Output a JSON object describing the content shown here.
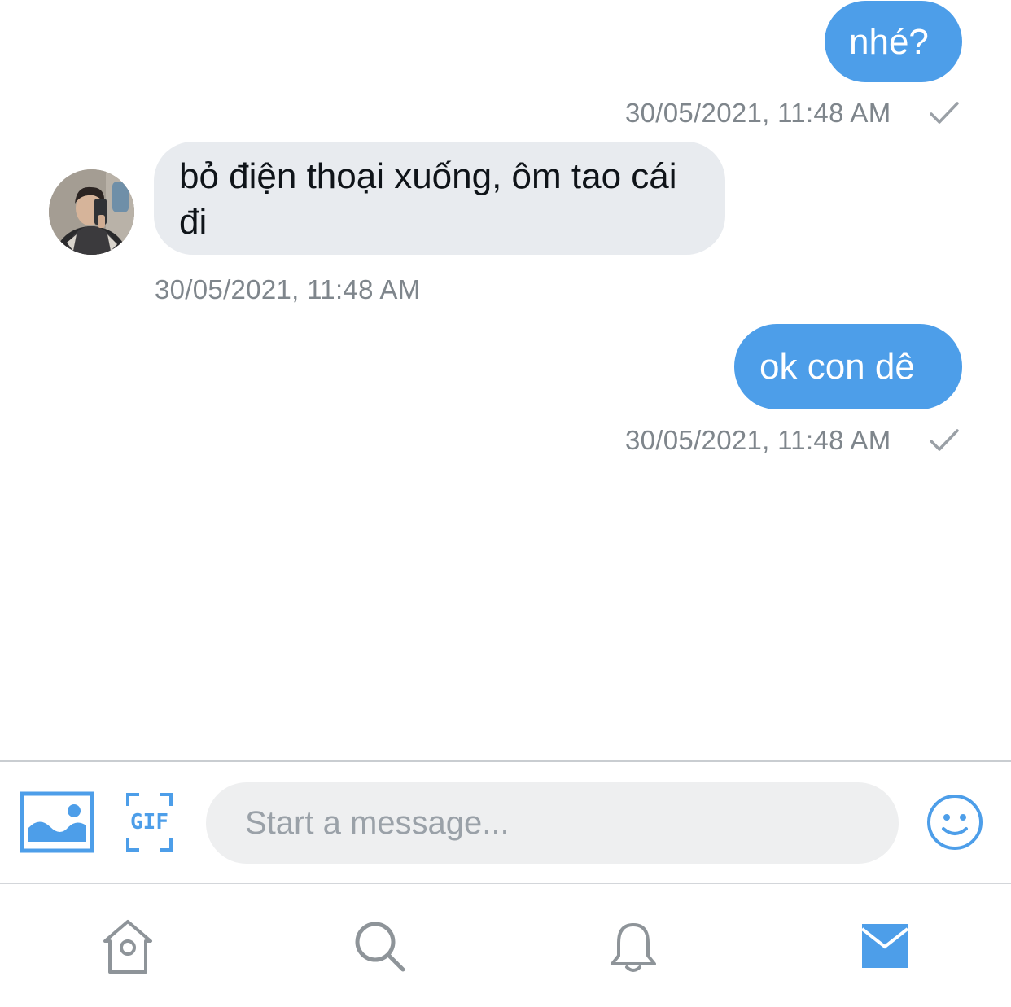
{
  "messages": [
    {
      "direction": "outgoing",
      "text": "nhé?",
      "timestamp": "30/05/2021, 11:48 AM"
    },
    {
      "direction": "incoming",
      "text": "bỏ điện thoại xuống, ôm tao cái đi",
      "timestamp": "30/05/2021, 11:48 AM"
    },
    {
      "direction": "outgoing",
      "text": "ok con dê",
      "timestamp": "30/05/2021, 11:48 AM"
    }
  ],
  "composer": {
    "placeholder": "Start a message...",
    "image_icon": "image-icon",
    "gif_label": "GIF",
    "emoji_icon": "emoji-icon"
  },
  "tab_bar": {
    "items": [
      "home-icon",
      "search-icon",
      "bell-icon",
      "mail-icon"
    ],
    "active": "mail-icon"
  },
  "colors": {
    "accent": "#4d9ee9",
    "incoming_bubble": "#e8ebef",
    "timestamp": "#7f868c",
    "inactive_icon": "#8e9499"
  }
}
